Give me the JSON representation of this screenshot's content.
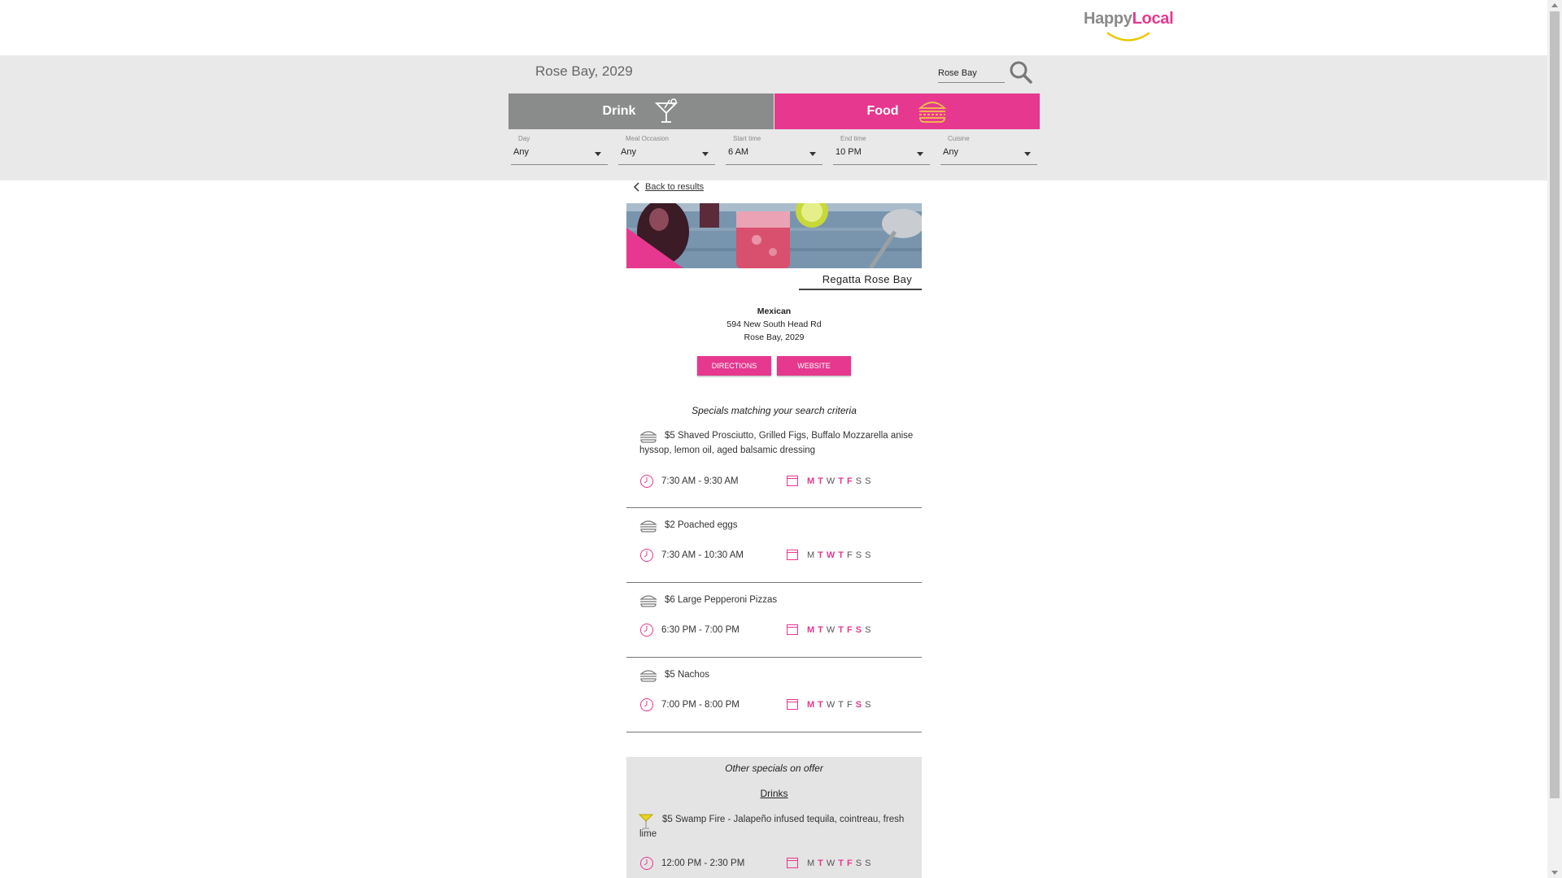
{
  "brand": {
    "name_part1": "Happy",
    "name_part2": "Local",
    "accent_color": "#e6388f",
    "grey_color": "#8a8a8a"
  },
  "search": {
    "location_title": "Rose Bay, 2029",
    "query_value": "Rose Bay",
    "search_icon": "magnifier-icon"
  },
  "tabs": [
    {
      "label": "Drink",
      "icon": "cocktail-icon",
      "active": false
    },
    {
      "label": "Food",
      "icon": "burger-icon",
      "active": true
    }
  ],
  "filters": [
    {
      "label": "Day",
      "value": "Any"
    },
    {
      "label": "Meal Occasion",
      "value": "Any"
    },
    {
      "label": "Start time",
      "value": "6 AM"
    },
    {
      "label": "End time",
      "value": "10 PM"
    },
    {
      "label": "Cuisine",
      "value": "Any"
    }
  ],
  "back_link": "Back to results",
  "venue": {
    "name": "Regatta Rose Bay",
    "cuisine": "Mexican",
    "address_line1": "594 New South Head Rd",
    "address_line2": "Rose Bay, 2029"
  },
  "buttons": {
    "directions": "DIRECTIONS",
    "website": "WEBSITE"
  },
  "matching_title": "Specials matching your search criteria",
  "day_letters": [
    "M",
    "T",
    "W",
    "T",
    "F",
    "S",
    "S"
  ],
  "specials": [
    {
      "text": "$5 Shaved Prosciutto, Grilled Figs, Buffalo Mozzarella anise hyssop, lemon oil, aged balsamic dressing",
      "time": "7:30 AM - 9:30 AM",
      "days_on": [
        true,
        true,
        false,
        true,
        true,
        false,
        false
      ]
    },
    {
      "text": "$2 Poached eggs",
      "time": "7:30 AM - 10:30 AM",
      "days_on": [
        false,
        true,
        true,
        true,
        false,
        false,
        false
      ]
    },
    {
      "text": "$6 Large Pepperoni Pizzas",
      "time": "6:30 PM - 7:00 PM",
      "days_on": [
        true,
        true,
        false,
        true,
        true,
        true,
        false
      ]
    },
    {
      "text": "$5 Nachos",
      "time": "7:00 PM - 8:00 PM",
      "days_on": [
        true,
        true,
        false,
        false,
        false,
        true,
        false
      ]
    }
  ],
  "other": {
    "title": "Other specials on offer",
    "drinks_heading": "Drinks",
    "items": [
      {
        "text": "$5 Swamp Fire - Jalapeño infused tequila, cointreau, fresh lime",
        "time": "12:00 PM - 2:30 PM",
        "days_on": [
          false,
          true,
          false,
          true,
          true,
          false,
          false
        ]
      }
    ]
  }
}
